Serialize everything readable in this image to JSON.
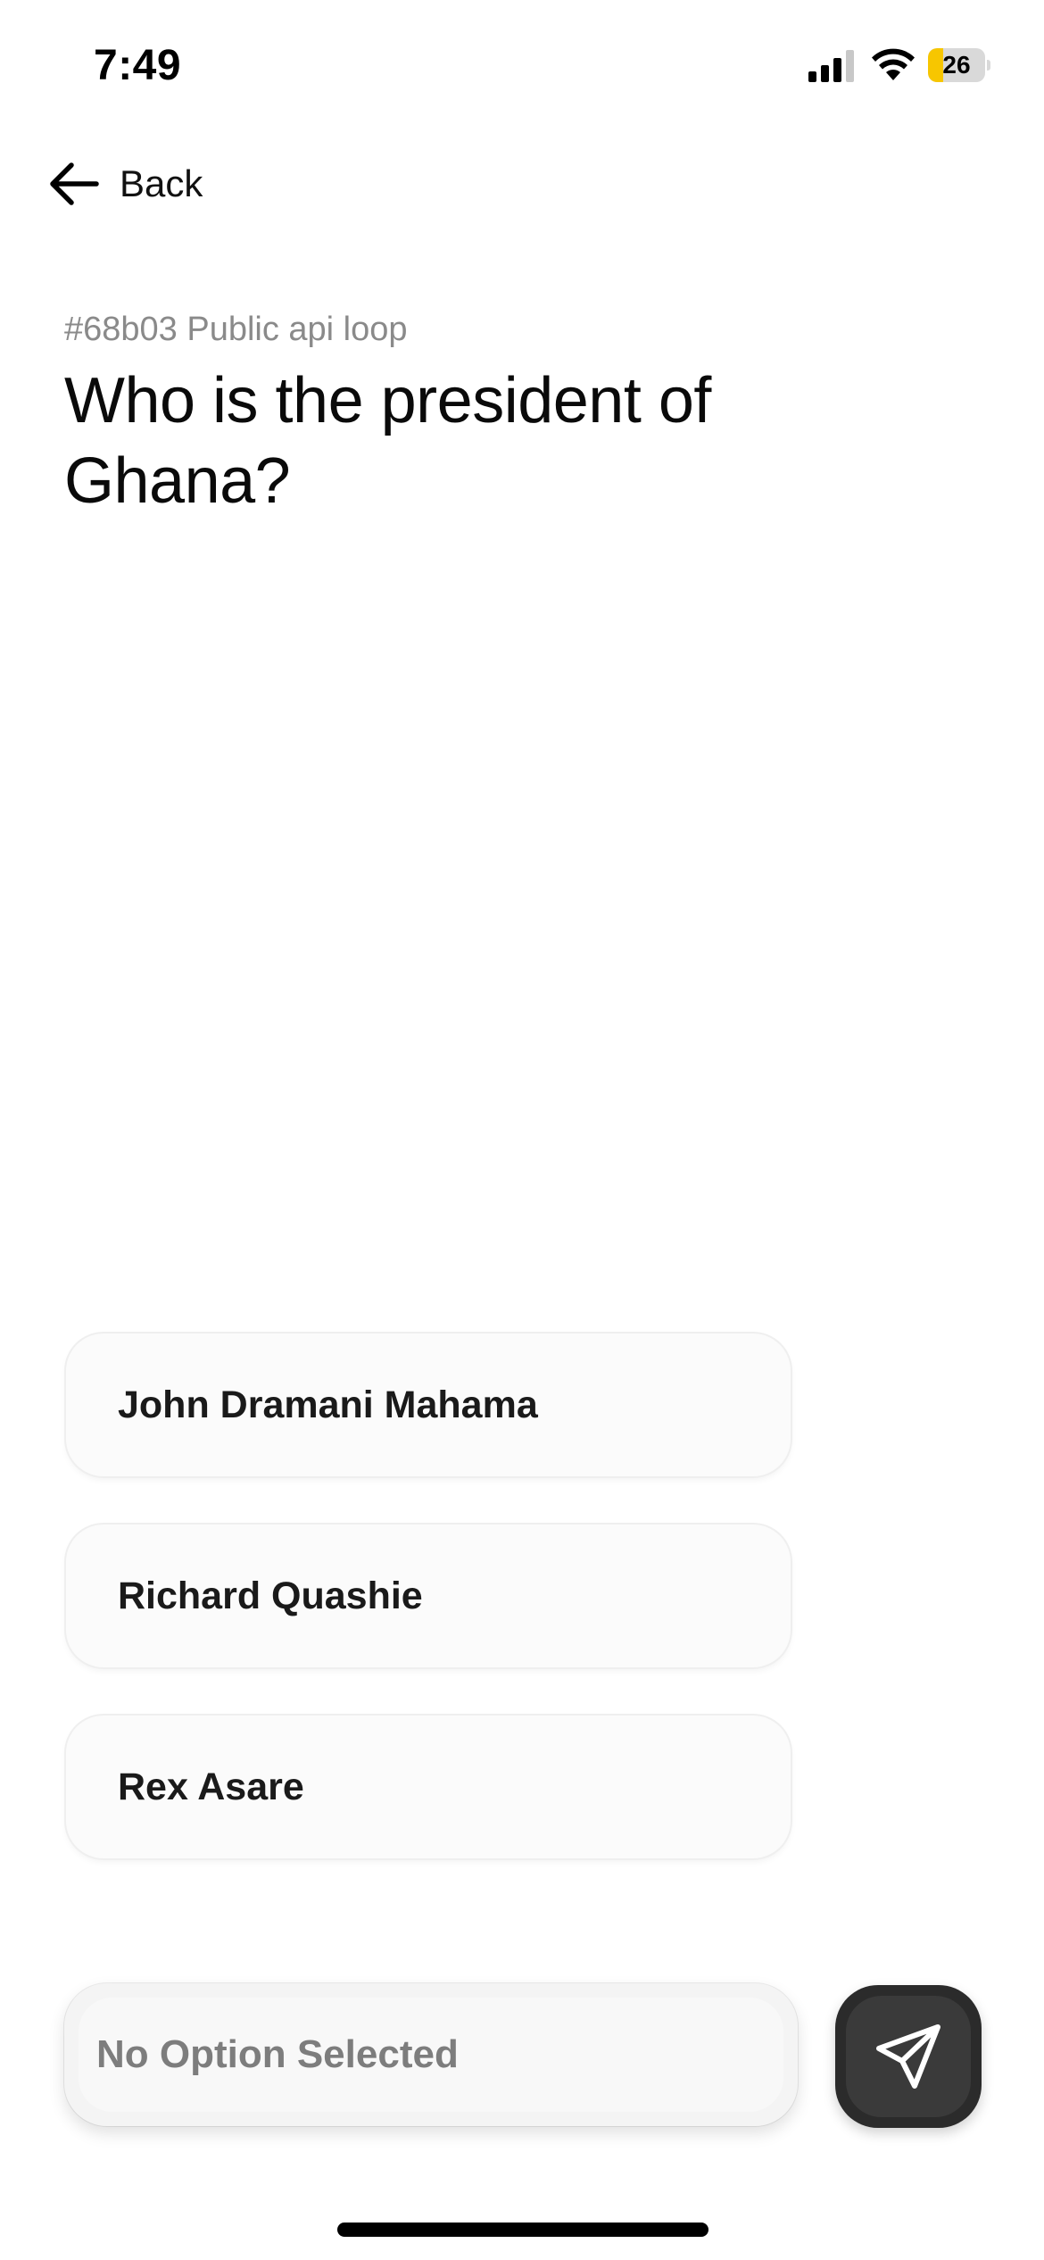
{
  "status_bar": {
    "time": "7:49",
    "battery_level": "26",
    "battery_fraction": 0.26,
    "battery_color": "#f7c600"
  },
  "nav": {
    "back_label": "Back",
    "back_icon": "arrow-left-icon"
  },
  "question": {
    "id_text": "#68b03 Public api loop",
    "title": "Who is the president of Ghana?"
  },
  "options": [
    {
      "label": "John Dramani Mahama"
    },
    {
      "label": "Richard Quashie"
    },
    {
      "label": "Rex Asare"
    }
  ],
  "footer": {
    "selection_text": "No Option Selected",
    "send_icon": "send-paper-plane-icon",
    "send_button_color": "#2b2b2b"
  }
}
